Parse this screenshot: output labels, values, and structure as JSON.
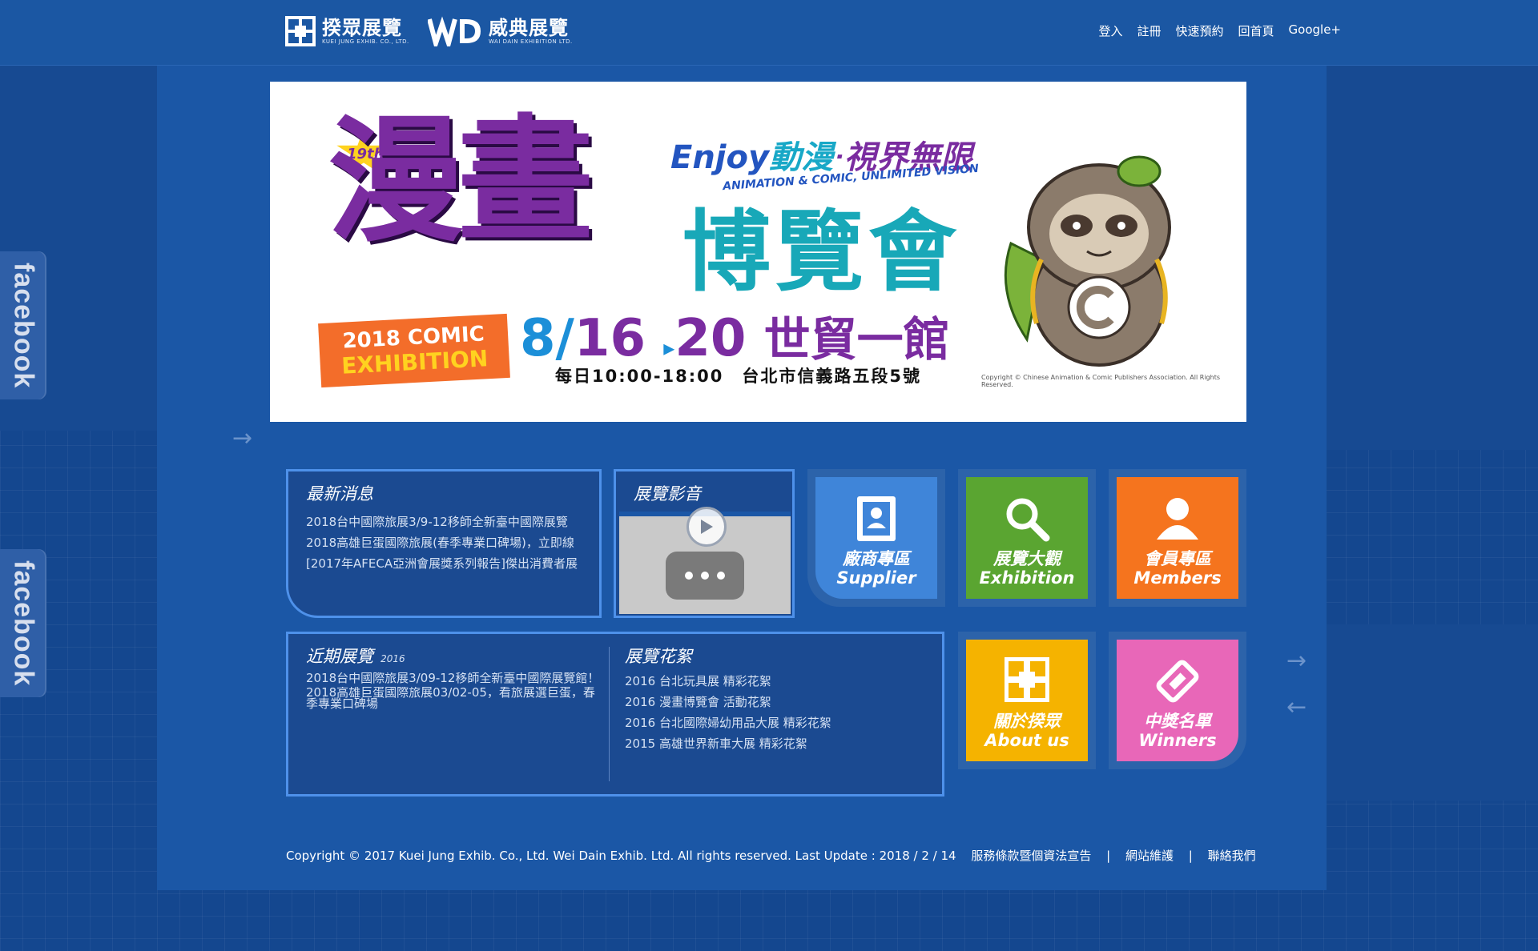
{
  "brand": {
    "logo1_title": "揆眾展覽",
    "logo1_sub": "KUEI JUNG EXHIB. CO., LTD.",
    "logo2_title": "威典展覽",
    "logo2_sub": "WAI DAIN EXHIBITION LTD."
  },
  "top_nav": [
    "登入",
    "註冊",
    "快速預約",
    "回首頁",
    "Google+"
  ],
  "side_tabs": [
    "facebook",
    "facebook"
  ],
  "banner": {
    "badge": "19th",
    "title_big": "漫畫",
    "tagline_enjoy": "Enjoy",
    "tagline_zh_1": "動漫",
    "tagline_zh_2": "‧視界無限",
    "tagline_en": "ANIMATION & COMIC, UNLIMITED VISION",
    "title_expo": "博覽會",
    "comic_line1": "2018 COMIC",
    "comic_line2": "EXHIBITION",
    "date_a": "8/",
    "date_b": "16",
    "date_arrow": "▸",
    "date_c": "20",
    "venue": "世貿一館",
    "hours": "每日10:00-18:00　台北市信義路五段5號",
    "copyright": "Copyright © Chinese Animation & Comic Publishers Association. All Rights Reserved."
  },
  "news": {
    "title": "最新消息",
    "items": [
      "2018台中國際旅展3/9-12移師全新臺中國際展覽",
      "2018高雄巨蛋國際旅展(春季專業口碑場)，立即線",
      "[2017年AFECA亞洲會展獎系列報告]傑出消費者展"
    ]
  },
  "video": {
    "title": "展覽影音"
  },
  "upcoming": {
    "title": "近期展覽",
    "year": "2016",
    "items": [
      "2018台中國際旅展3/09-12移師全新臺中國際展覽館！",
      "2018高雄巨蛋國際旅展03/02-05，看旅展選巨蛋，春季專業口碑場"
    ]
  },
  "highlights": {
    "title": "展覽花絮",
    "items": [
      "2016 台北玩具展 精彩花絮",
      "2016 漫畫博覽會 活動花絮",
      "2016 台北國際婦幼用品大展 精彩花絮",
      "2015 高雄世界新車大展 精彩花絮"
    ]
  },
  "tiles": {
    "supplier": {
      "zh": "廠商專區",
      "en": "Supplier",
      "color": "#3f85d9"
    },
    "exhibition": {
      "zh": "展覽大觀",
      "en": "Exhibition",
      "color": "#5aa531"
    },
    "members": {
      "zh": "會員專區",
      "en": "Members",
      "color": "#f5741e"
    },
    "about": {
      "zh": "關於揆眾",
      "en": "About us",
      "color": "#f5b300"
    },
    "winners": {
      "zh": "中獎名單",
      "en": "Winners",
      "color": "#e867b8"
    }
  },
  "footer": {
    "copyright": "Copyright © 2017 Kuei Jung Exhib. Co., Ltd. Wei Dain Exhib. Ltd. All rights reserved. Last Update : 2018 / 2 / 14",
    "link1": "服務條款暨個資法宣告",
    "sep": "|",
    "link2": "網站維護",
    "link3": "聯絡我們"
  },
  "arrows": {
    "right": "→",
    "left": "←"
  }
}
